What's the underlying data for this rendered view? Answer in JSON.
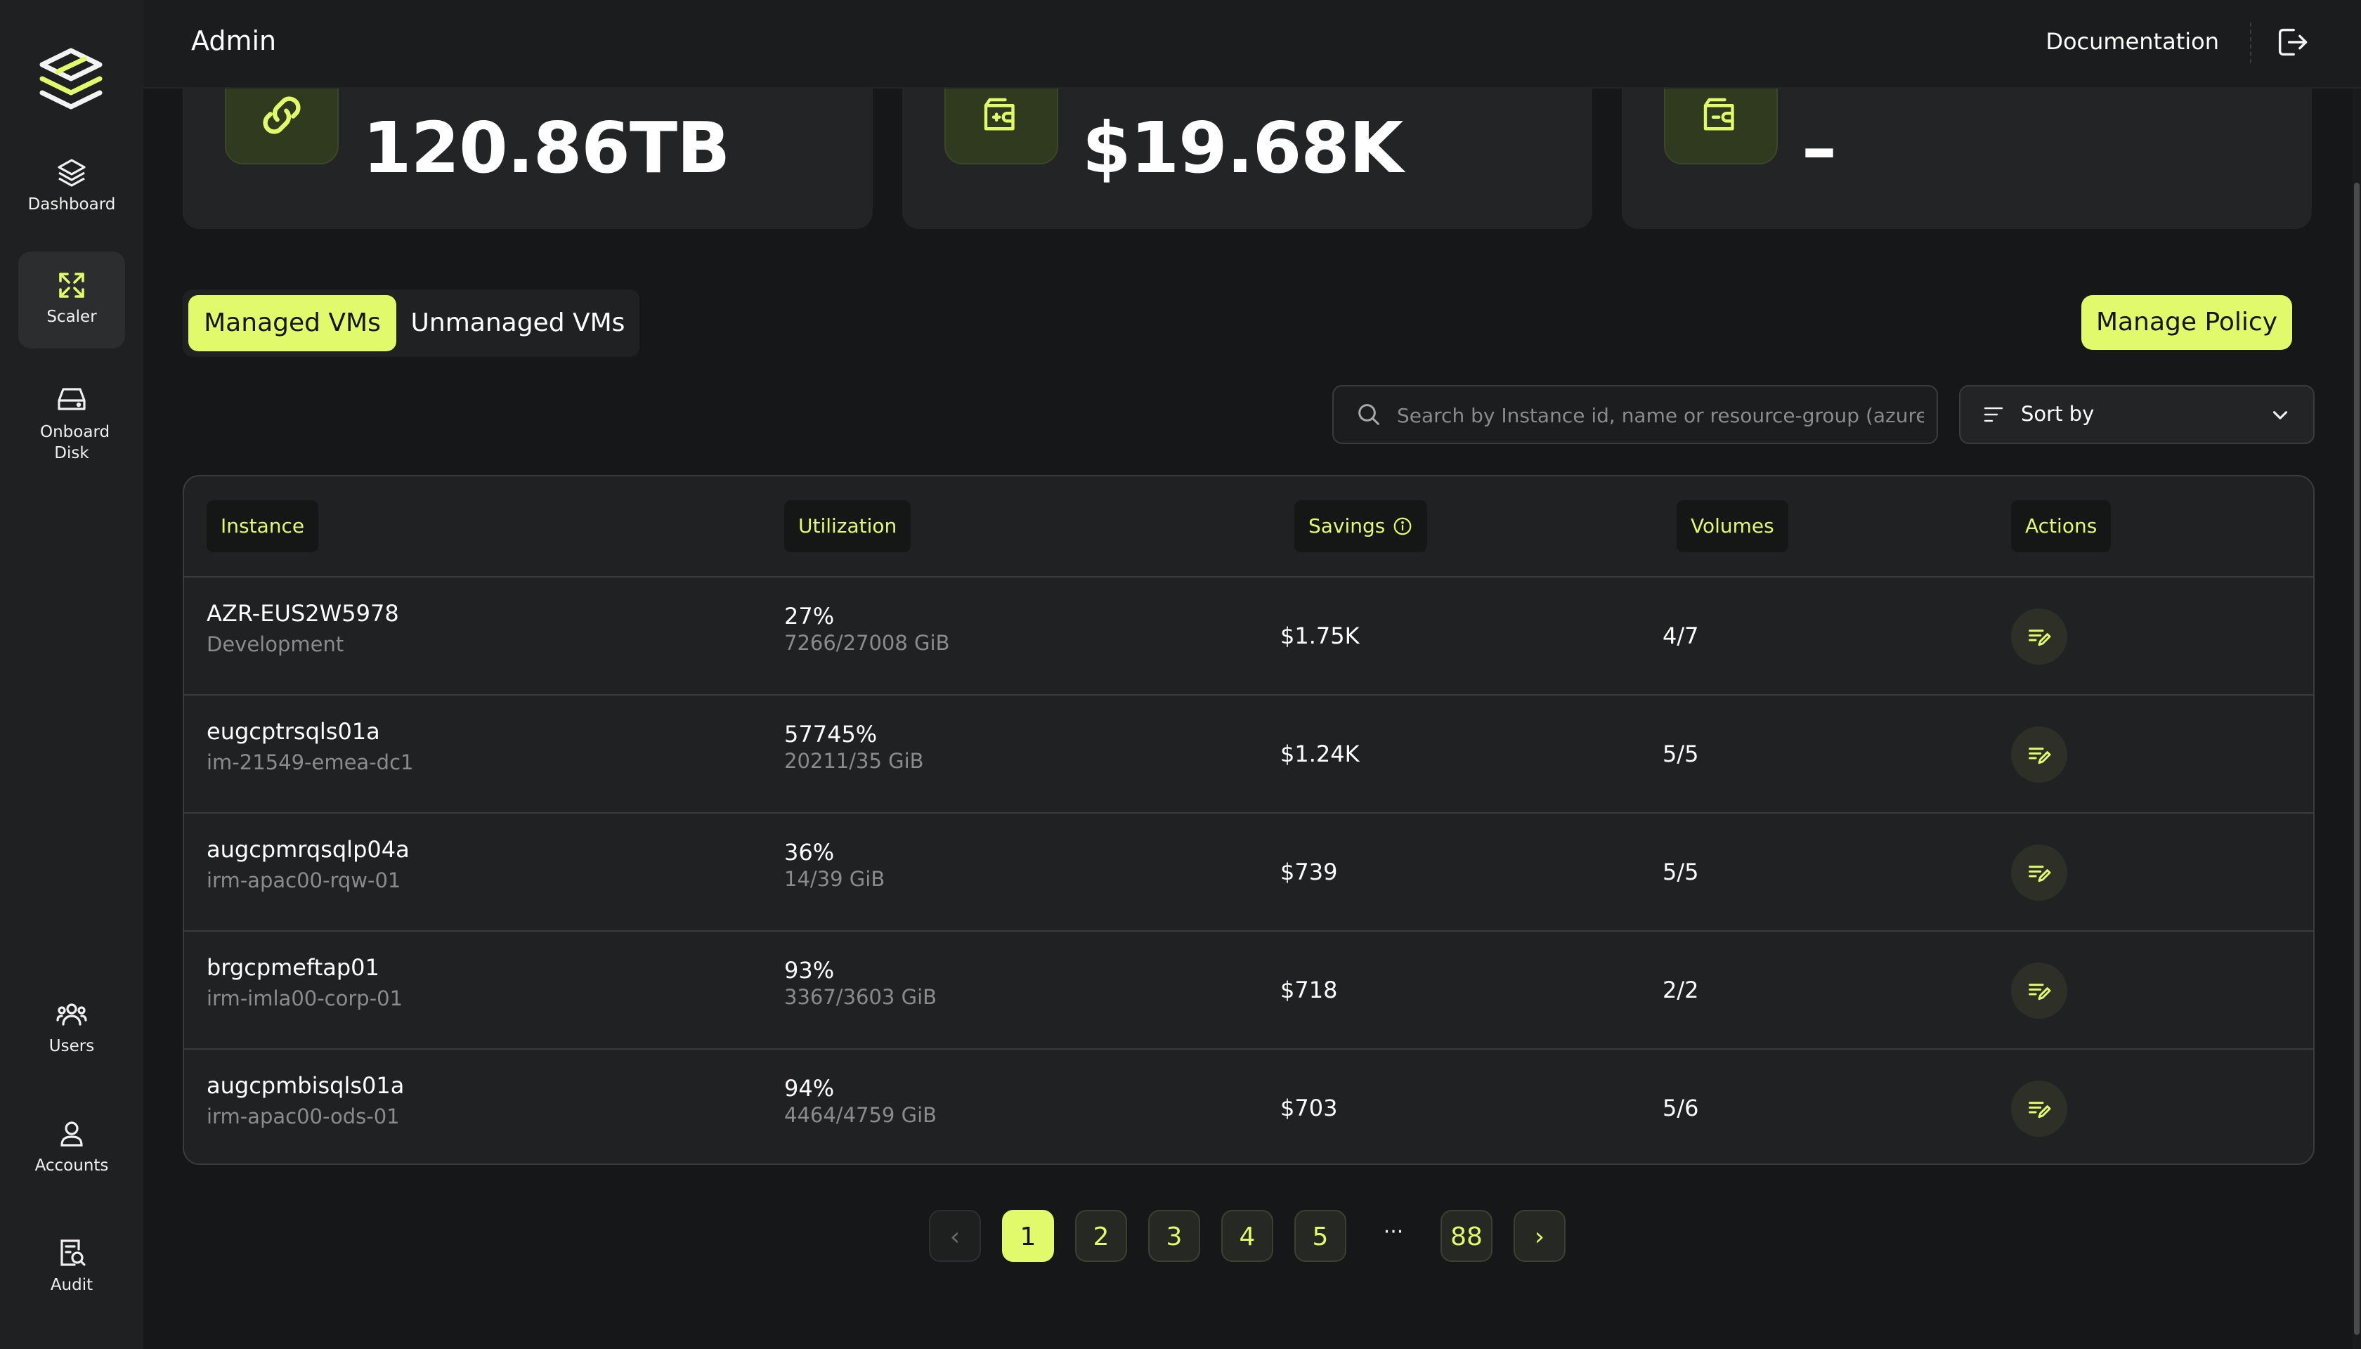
{
  "app": {
    "title": "Admin"
  },
  "header": {
    "documentation_label": "Documentation"
  },
  "sidebar": {
    "items": [
      {
        "label": "Dashboard",
        "icon": "layers-icon"
      },
      {
        "label": "Scaler",
        "icon": "expand-icon",
        "active": true
      },
      {
        "label": "Onboard Disk",
        "icon": "hard-drive-icon"
      },
      {
        "label": "Users",
        "icon": "users-icon"
      },
      {
        "label": "Accounts",
        "icon": "user-icon"
      },
      {
        "label": "Audit",
        "icon": "audit-search-icon"
      }
    ]
  },
  "stats": [
    {
      "value": "120.86TB",
      "icon": "link-icon"
    },
    {
      "value": "$19.68K",
      "icon": "wallet-plus-icon"
    },
    {
      "value": "–",
      "icon": "wallet-minus-icon"
    }
  ],
  "tabs": [
    {
      "label": "Managed VMs",
      "active": true
    },
    {
      "label": "Unmanaged VMs",
      "active": false
    }
  ],
  "manage_policy_label": "Manage Policy",
  "search": {
    "placeholder": "Search by Instance id, name or resource-group (azure only)",
    "value": ""
  },
  "sort": {
    "label": "Sort by"
  },
  "table": {
    "columns": [
      "Instance",
      "Utilization",
      "Savings",
      "Volumes",
      "Actions"
    ],
    "rows": [
      {
        "name": "AZR-EUS2W5978",
        "group": "Development",
        "util_pct": "27%",
        "util_detail": "7266/27008 GiB",
        "savings": "$1.75K",
        "volumes": "4/7"
      },
      {
        "name": "eugcptrsqls01a",
        "group": "im-21549-emea-dc1",
        "util_pct": "57745%",
        "util_detail": "20211/35 GiB",
        "savings": "$1.24K",
        "volumes": "5/5"
      },
      {
        "name": "augcpmrqsqlp04a",
        "group": "irm-apac00-rqw-01",
        "util_pct": "36%",
        "util_detail": "14/39 GiB",
        "savings": "$739",
        "volumes": "5/5"
      },
      {
        "name": "brgcpmeftap01",
        "group": "irm-imla00-corp-01",
        "util_pct": "93%",
        "util_detail": "3367/3603 GiB",
        "savings": "$718",
        "volumes": "2/2"
      },
      {
        "name": "augcpmbisqls01a",
        "group": "irm-apac00-ods-01",
        "util_pct": "94%",
        "util_detail": "4464/4759 GiB",
        "savings": "$703",
        "volumes": "5/6"
      }
    ]
  },
  "pagination": {
    "pages": [
      "1",
      "2",
      "3",
      "4",
      "5"
    ],
    "ellipsis": "···",
    "last": "88",
    "current": "1",
    "prev": "‹",
    "next": "›"
  },
  "colors": {
    "accent": "#e1fa6c",
    "background": "#161718",
    "surface": "#232425"
  }
}
